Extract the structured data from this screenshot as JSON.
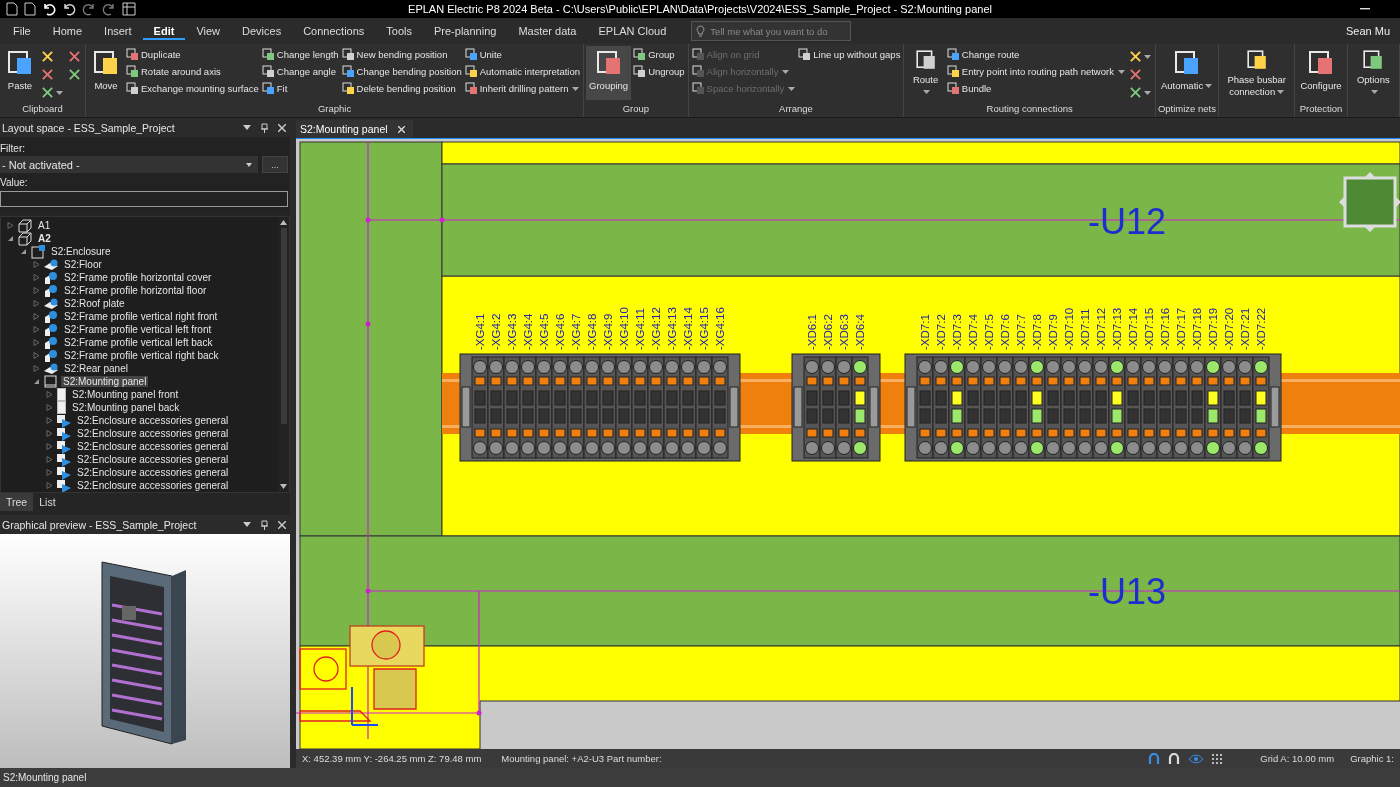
{
  "window": {
    "title": "EPLAN Electric P8 2024 Beta - C:\\Users\\Public\\EPLAN\\Data\\Projects\\V2024\\ESS_Sample_Project - S2:Mounting panel"
  },
  "menu": {
    "tabs": [
      {
        "label": "File",
        "selected": false
      },
      {
        "label": "Home",
        "selected": false
      },
      {
        "label": "Insert",
        "selected": false
      },
      {
        "label": "Edit",
        "selected": true
      },
      {
        "label": "View",
        "selected": false
      },
      {
        "label": "Devices",
        "selected": false
      },
      {
        "label": "Connections",
        "selected": false
      },
      {
        "label": "Tools",
        "selected": false
      },
      {
        "label": "Pre-planning",
        "selected": false
      },
      {
        "label": "Master data",
        "selected": false
      },
      {
        "label": "EPLAN Cloud",
        "selected": false
      }
    ],
    "search": {
      "placeholder": "Tell me what you want to do"
    },
    "user": "Sean Mu"
  },
  "ribbon": {
    "groups": [
      {
        "label": "Clipboard",
        "columns": [
          [
            {
              "kind": "large",
              "label": "Paste",
              "on": false,
              "disabled": false,
              "dropdown": false
            }
          ],
          [
            {
              "kind": "icon",
              "on": false,
              "disabled": false,
              "dropdown": false
            },
            {
              "kind": "icon",
              "on": false,
              "disabled": false,
              "dropdown": false
            },
            {
              "kind": "icon",
              "on": false,
              "disabled": false,
              "dropdown": true
            }
          ],
          [
            {
              "kind": "icon",
              "on": false,
              "disabled": false,
              "dropdown": false
            },
            {
              "kind": "icon",
              "on": false,
              "disabled": false,
              "dropdown": false
            }
          ]
        ]
      },
      {
        "label": "Graphic",
        "columns": [
          [
            {
              "kind": "large",
              "label": "Move",
              "on": false,
              "disabled": false,
              "dropdown": false
            }
          ],
          [
            {
              "kind": "small",
              "label": "Duplicate",
              "on": false,
              "disabled": false,
              "dropdown": false
            },
            {
              "kind": "small",
              "label": "Rotate around axis",
              "on": false,
              "disabled": false,
              "dropdown": false
            },
            {
              "kind": "small",
              "label": "Exchange mounting surface",
              "on": false,
              "disabled": false,
              "dropdown": false
            }
          ],
          [
            {
              "kind": "small",
              "label": "Change length",
              "on": false,
              "disabled": false,
              "dropdown": false
            },
            {
              "kind": "small",
              "label": "Change angle",
              "on": false,
              "disabled": false,
              "dropdown": false
            },
            {
              "kind": "small",
              "label": "Fit",
              "on": false,
              "disabled": false,
              "dropdown": false
            }
          ],
          [
            {
              "kind": "small",
              "label": "New bending position",
              "on": false,
              "disabled": false,
              "dropdown": false
            },
            {
              "kind": "small",
              "label": "Change bending position",
              "on": false,
              "disabled": false,
              "dropdown": false
            },
            {
              "kind": "small",
              "label": "Delete bending position",
              "on": false,
              "disabled": false,
              "dropdown": false
            }
          ],
          [
            {
              "kind": "small",
              "label": "Unite",
              "on": false,
              "disabled": false,
              "dropdown": false
            },
            {
              "kind": "small",
              "label": "Automatic interpretation",
              "on": false,
              "disabled": false,
              "dropdown": false
            },
            {
              "kind": "small",
              "label": "Inherit drilling pattern",
              "on": false,
              "disabled": false,
              "dropdown": true
            }
          ]
        ]
      },
      {
        "label": "Group",
        "columns": [
          [
            {
              "kind": "large",
              "label": "Grouping",
              "on": true,
              "disabled": false,
              "dropdown": false
            }
          ],
          [
            {
              "kind": "small",
              "label": "Group",
              "on": false,
              "disabled": false,
              "dropdown": false
            },
            {
              "kind": "small",
              "label": "Ungroup",
              "on": false,
              "disabled": false,
              "dropdown": false
            }
          ]
        ]
      },
      {
        "label": "Arrange",
        "columns": [
          [
            {
              "kind": "small",
              "label": "Align on grid",
              "on": false,
              "disabled": true,
              "dropdown": false
            },
            {
              "kind": "small",
              "label": "Align horizontally",
              "on": false,
              "disabled": true,
              "dropdown": true
            },
            {
              "kind": "small",
              "label": "Space horizontally",
              "on": false,
              "disabled": true,
              "dropdown": true
            }
          ],
          [
            {
              "kind": "small",
              "label": "Line up without gaps",
              "on": false,
              "disabled": false,
              "dropdown": false
            }
          ]
        ]
      },
      {
        "label": "Routing connections",
        "columns": [
          [
            {
              "kind": "large",
              "label": "Route",
              "on": false,
              "disabled": false,
              "dropdown": true
            }
          ],
          [
            {
              "kind": "small",
              "label": "Change route",
              "on": false,
              "disabled": false,
              "dropdown": false
            },
            {
              "kind": "small",
              "label": "Entry point into routing path network",
              "on": false,
              "disabled": false,
              "dropdown": true
            },
            {
              "kind": "small",
              "label": "Bundle",
              "on": false,
              "disabled": false,
              "dropdown": false
            }
          ],
          [
            {
              "kind": "icon",
              "on": false,
              "disabled": false,
              "dropdown": true
            },
            {
              "kind": "icon",
              "on": false,
              "disabled": false,
              "dropdown": false
            },
            {
              "kind": "icon",
              "on": false,
              "disabled": false,
              "dropdown": true
            }
          ]
        ]
      },
      {
        "label": "Optimize nets",
        "columns": [
          [
            {
              "kind": "large",
              "label": "Automatic",
              "on": false,
              "disabled": false,
              "dropdown": true
            }
          ]
        ]
      },
      {
        "columns": [
          [
            {
              "kind": "large",
              "label": "Phase busbar connection",
              "on": false,
              "disabled": false,
              "dropdown": true
            }
          ]
        ]
      },
      {
        "label": "Protection",
        "columns": [
          [
            {
              "kind": "large",
              "label": "Configure",
              "on": false,
              "disabled": false,
              "dropdown": false
            }
          ]
        ]
      },
      {
        "columns": [
          [
            {
              "kind": "large",
              "label": "Options",
              "on": false,
              "disabled": false,
              "dropdown": true
            }
          ]
        ]
      }
    ]
  },
  "layout_panel": {
    "title": "Layout space - ESS_Sample_Project",
    "filter_label": "Filter:",
    "filter_value": "- Not activated -",
    "more_button": "...",
    "value_label": "Value:",
    "tree": [
      {
        "label": "A1",
        "kind": "location",
        "bold": false,
        "expanded": false,
        "selected": false
      },
      {
        "label": "A2",
        "kind": "location",
        "bold": true,
        "expanded": true,
        "selected": false,
        "children": [
          {
            "label": "S2:Enclosure",
            "kind": "enclosure",
            "bold": false,
            "expanded": true,
            "selected": false,
            "children": [
              {
                "label": "S2:Floor",
                "kind": "plate",
                "bold": false,
                "expanded": false,
                "selected": false
              },
              {
                "label": "S2:Frame profile horizontal cover",
                "kind": "profile",
                "bold": false,
                "expanded": false,
                "selected": false
              },
              {
                "label": "S2:Frame profile horizontal floor",
                "kind": "profile",
                "bold": false,
                "expanded": false,
                "selected": false
              },
              {
                "label": "S2:Roof plate",
                "kind": "plate",
                "bold": false,
                "expanded": false,
                "selected": false
              },
              {
                "label": "S2:Frame profile vertical right front",
                "kind": "profile",
                "bold": false,
                "expanded": false,
                "selected": false
              },
              {
                "label": "S2:Frame profile vertical left front",
                "kind": "profile",
                "bold": false,
                "expanded": false,
                "selected": false
              },
              {
                "label": "S2:Frame profile vertical left back",
                "kind": "profile",
                "bold": false,
                "expanded": false,
                "selected": false
              },
              {
                "label": "S2:Frame profile vertical right back",
                "kind": "profile",
                "bold": false,
                "expanded": false,
                "selected": false
              },
              {
                "label": "S2:Rear panel",
                "kind": "plate",
                "bold": false,
                "expanded": false,
                "selected": false
              },
              {
                "label": "S2:Mounting panel",
                "kind": "panel",
                "bold": false,
                "expanded": true,
                "selected": true,
                "children": [
                  {
                    "label": "S2:Mounting panel front",
                    "kind": "side",
                    "bold": false,
                    "expanded": false,
                    "selected": false
                  },
                  {
                    "label": "S2:Mounting panel back",
                    "kind": "side",
                    "bold": false,
                    "expanded": false,
                    "selected": false
                  },
                  {
                    "label": "S2:Enclosure accessories general",
                    "kind": "accessory",
                    "bold": false,
                    "expanded": false,
                    "selected": false
                  },
                  {
                    "label": "S2:Enclosure accessories general",
                    "kind": "accessory",
                    "bold": false,
                    "expanded": false,
                    "selected": false
                  },
                  {
                    "label": "S2:Enclosure accessories general",
                    "kind": "accessory",
                    "bold": false,
                    "expanded": false,
                    "selected": false
                  },
                  {
                    "label": "S2:Enclosure accessories general",
                    "kind": "accessory",
                    "bold": false,
                    "expanded": false,
                    "selected": false
                  },
                  {
                    "label": "S2:Enclosure accessories general",
                    "kind": "accessory",
                    "bold": false,
                    "expanded": false,
                    "selected": false
                  },
                  {
                    "label": "S2:Enclosure accessories general",
                    "kind": "accessory",
                    "bold": false,
                    "expanded": false,
                    "selected": false
                  }
                ]
              }
            ]
          }
        ]
      }
    ],
    "tabs": [
      {
        "label": "Tree",
        "selected": true
      },
      {
        "label": "List",
        "selected": false
      }
    ]
  },
  "preview_panel": {
    "title": "Graphical preview - ESS_Sample_Project"
  },
  "document_tab": {
    "label": "S2:Mounting panel"
  },
  "drawing": {
    "devices": [
      "-U12",
      "-U13"
    ],
    "strips": [
      {
        "terminals": [
          {
            "label": "-XG4:1",
            "highlighted": false
          },
          {
            "label": "-XG4:2",
            "highlighted": false
          },
          {
            "label": "-XG4:3",
            "highlighted": false
          },
          {
            "label": "-XG4:4",
            "highlighted": false
          },
          {
            "label": "-XG4:5",
            "highlighted": false
          },
          {
            "label": "-XG4:6",
            "highlighted": false
          },
          {
            "label": "-XG4:7",
            "highlighted": false
          },
          {
            "label": "-XG4:8",
            "highlighted": false
          },
          {
            "label": "-XG4:9",
            "highlighted": false
          },
          {
            "label": "-XG4:10",
            "highlighted": false
          },
          {
            "label": "-XG4:11",
            "highlighted": false
          },
          {
            "label": "-XG4:12",
            "highlighted": false
          },
          {
            "label": "-XG4:13",
            "highlighted": false
          },
          {
            "label": "-XG4:14",
            "highlighted": false
          },
          {
            "label": "-XG4:15",
            "highlighted": false
          },
          {
            "label": "-XG4:16",
            "highlighted": false
          }
        ]
      },
      {
        "terminals": [
          {
            "label": "-XD6:1",
            "highlighted": false
          },
          {
            "label": "-XD6:2",
            "highlighted": false
          },
          {
            "label": "-XD6:3",
            "highlighted": false
          },
          {
            "label": "-XD6:4",
            "highlighted": true
          }
        ]
      },
      {
        "terminals": [
          {
            "label": "-XD7:1",
            "highlighted": false
          },
          {
            "label": "-XD7:2",
            "highlighted": false
          },
          {
            "label": "-XD7:3",
            "highlighted": true
          },
          {
            "label": "-XD7:4",
            "highlighted": false
          },
          {
            "label": "-XD7:5",
            "highlighted": false
          },
          {
            "label": "-XD7:6",
            "highlighted": false
          },
          {
            "label": "-XD7:7",
            "highlighted": false
          },
          {
            "label": "-XD7:8",
            "highlighted": true
          },
          {
            "label": "-XD7:9",
            "highlighted": false
          },
          {
            "label": "-XD7:10",
            "highlighted": false
          },
          {
            "label": "-XD7:11",
            "highlighted": false
          },
          {
            "label": "-XD7:12",
            "highlighted": false
          },
          {
            "label": "-XD7:13",
            "highlighted": true
          },
          {
            "label": "-XD7:14",
            "highlighted": false
          },
          {
            "label": "-XD7:15",
            "highlighted": false
          },
          {
            "label": "-XD7:16",
            "highlighted": false
          },
          {
            "label": "-XD7:17",
            "highlighted": false
          },
          {
            "label": "-XD7:18",
            "highlighted": false
          },
          {
            "label": "-XD7:19",
            "highlighted": true
          },
          {
            "label": "-XD7:20",
            "highlighted": false
          },
          {
            "label": "-XD7:21",
            "highlighted": false
          },
          {
            "label": "-XD7:22",
            "highlighted": true
          }
        ]
      }
    ]
  },
  "canvas_status": {
    "coordinates": "X: 452.39 mm Y: -264.25 mm Z: 79.48 mm",
    "info": "Mounting panel: +A2-U3 Part number:",
    "grid": "Grid A: 10.00 mm",
    "scale": "Graphic 1:"
  },
  "status_bar": "S2:Mounting panel"
}
